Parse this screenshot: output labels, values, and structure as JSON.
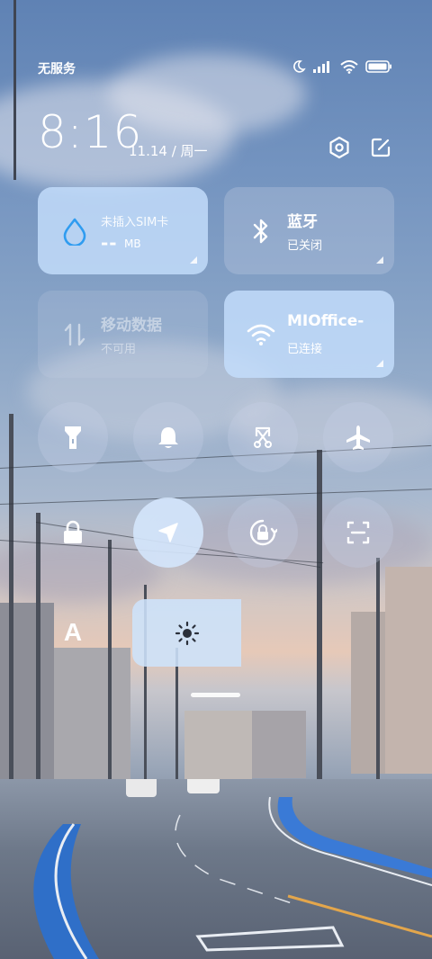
{
  "status_bar": {
    "carrier": "无服务",
    "icons": [
      "moon-icon",
      "signal-icon",
      "wifi-icon",
      "battery-icon"
    ]
  },
  "clock": {
    "time": "8:16",
    "date": "11.14 / 周一"
  },
  "header_buttons": [
    "settings-icon",
    "edit-icon"
  ],
  "tiles": {
    "data_usage": {
      "title": "未插入SIM卡",
      "value": "--",
      "unit": "MB",
      "icon": "droplet-icon"
    },
    "bluetooth": {
      "title": "蓝牙",
      "subtitle": "已关闭",
      "icon": "bluetooth-icon"
    },
    "mobile_data": {
      "title": "移动数据",
      "subtitle": "不可用",
      "icon": "data-arrows-icon"
    },
    "wifi": {
      "title": "MIOffice-",
      "subtitle": "已连接",
      "icon": "wifi-icon"
    }
  },
  "toggles": [
    {
      "name": "flashlight",
      "icon": "flashlight-icon",
      "active": false
    },
    {
      "name": "ringer",
      "icon": "bell-icon",
      "active": false
    },
    {
      "name": "screenshot",
      "icon": "scissors-screenshot-icon",
      "active": false
    },
    {
      "name": "airplane",
      "icon": "airplane-icon",
      "active": false
    },
    {
      "name": "lock-screen",
      "icon": "lock-icon",
      "active": false
    },
    {
      "name": "location",
      "icon": "location-arrow-icon",
      "active": true
    },
    {
      "name": "rotation-lock",
      "icon": "rotation-lock-icon",
      "active": false
    },
    {
      "name": "scanner",
      "icon": "scan-icon",
      "active": false
    }
  ],
  "brightness": {
    "auto_icon": "auto-brightness-icon",
    "auto_label": "A",
    "icon": "sun-icon",
    "level": 0.25
  },
  "colors": {
    "tile_on": "#c4defc",
    "accent_droplet": "#2f9cf0"
  }
}
